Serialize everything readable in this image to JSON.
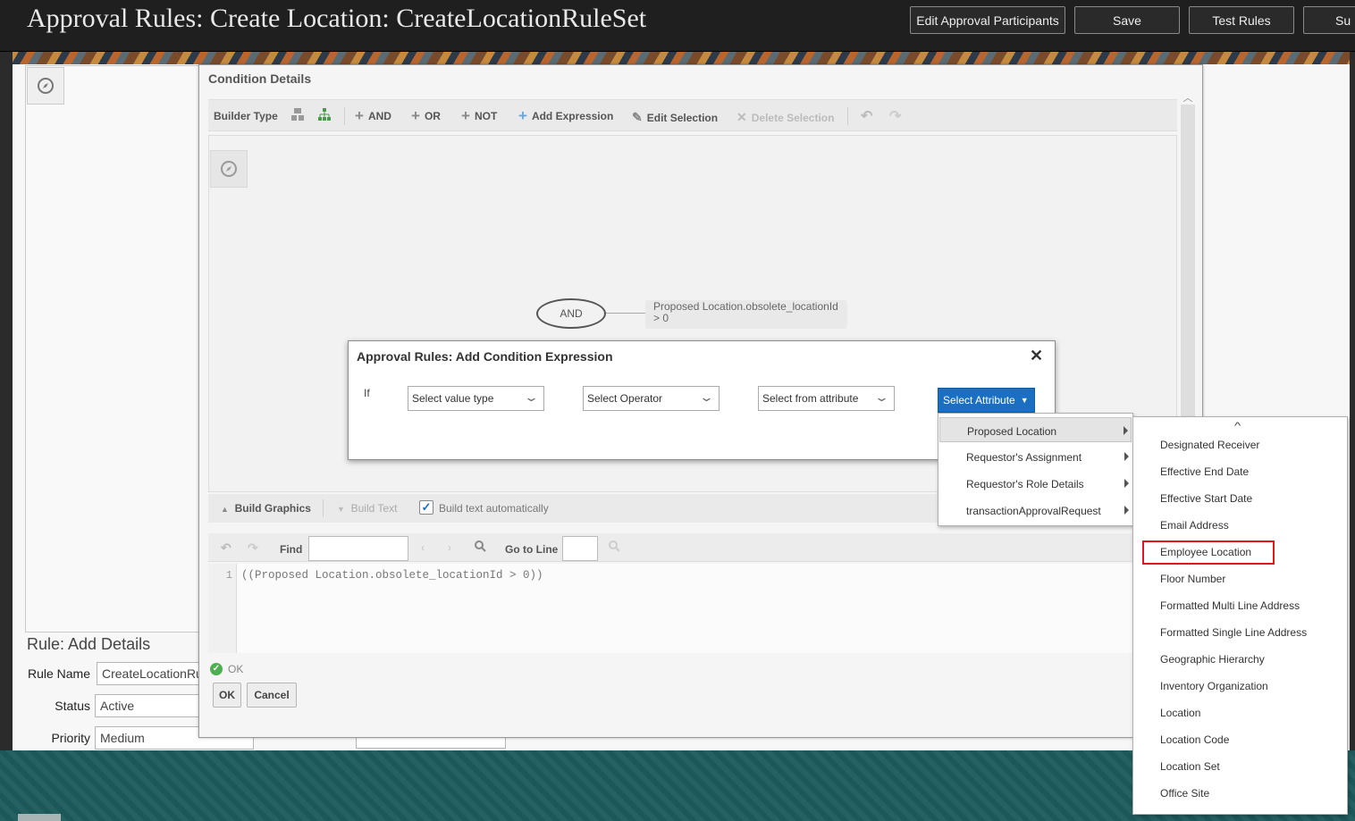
{
  "header": {
    "title": "Approval Rules: Create Location: CreateLocationRuleSet",
    "buttons": [
      "Edit Approval Participants",
      "Save",
      "Test Rules",
      "Su"
    ]
  },
  "background_form": {
    "heading": "Rule: Add Details",
    "fields": [
      {
        "label": "Rule Name",
        "value": "CreateLocationRu"
      },
      {
        "label": "Status",
        "value": "Active"
      },
      {
        "label": "Priority",
        "value": "Medium"
      }
    ]
  },
  "condition_details": {
    "title": "Condition Details",
    "toolbar": {
      "builder_type": "Builder Type",
      "and": "AND",
      "or": "OR",
      "not": "NOT",
      "add_expression": "Add Expression",
      "edit_selection": "Edit Selection",
      "delete_selection": "Delete Selection"
    },
    "graph": {
      "and_node": "AND",
      "expression_line1": "Proposed Location.obsolete_locationId",
      "expression_line2": "> 0"
    },
    "build": {
      "build_graphics": "Build Graphics",
      "build_text": "Build Text",
      "build_text_auto": "Build text automatically",
      "build_text_auto_checked": true
    },
    "find": {
      "find_label": "Find",
      "goto_label": "Go to Line"
    },
    "editor": {
      "line_number": "1",
      "code": "((Proposed Location.obsolete_locationId > 0))"
    },
    "status": "OK",
    "ok_button": "OK",
    "cancel_button": "Cancel"
  },
  "modal": {
    "title": "Approval Rules: Add Condition Expression",
    "if_label": "If",
    "value_type_placeholder": "Select value type",
    "operator_placeholder": "Select Operator",
    "attribute_placeholder": "Select from attribute",
    "select_attribute_button": "Select Attribute"
  },
  "attribute_menu": {
    "items": [
      "Proposed Location",
      "Requestor's Assignment",
      "Requestor's Role Details",
      "transactionApprovalRequest"
    ],
    "active_index": 0
  },
  "submenu": {
    "items": [
      "Designated Receiver",
      "Effective End Date",
      "Effective Start Date",
      "Email Address",
      "Employee Location",
      "Floor Number",
      "Formatted Multi Line Address",
      "Formatted Single Line Address",
      "Geographic Hierarchy",
      "Inventory Organization",
      "Location",
      "Location Code",
      "Location Set",
      "Office Site"
    ],
    "highlighted": "Employee Location"
  },
  "colors": {
    "accent": "#1b6fc2",
    "highlight": "#e0181b",
    "header_bg": "#1f1f1f",
    "footer_band": "#1e5c5e"
  }
}
